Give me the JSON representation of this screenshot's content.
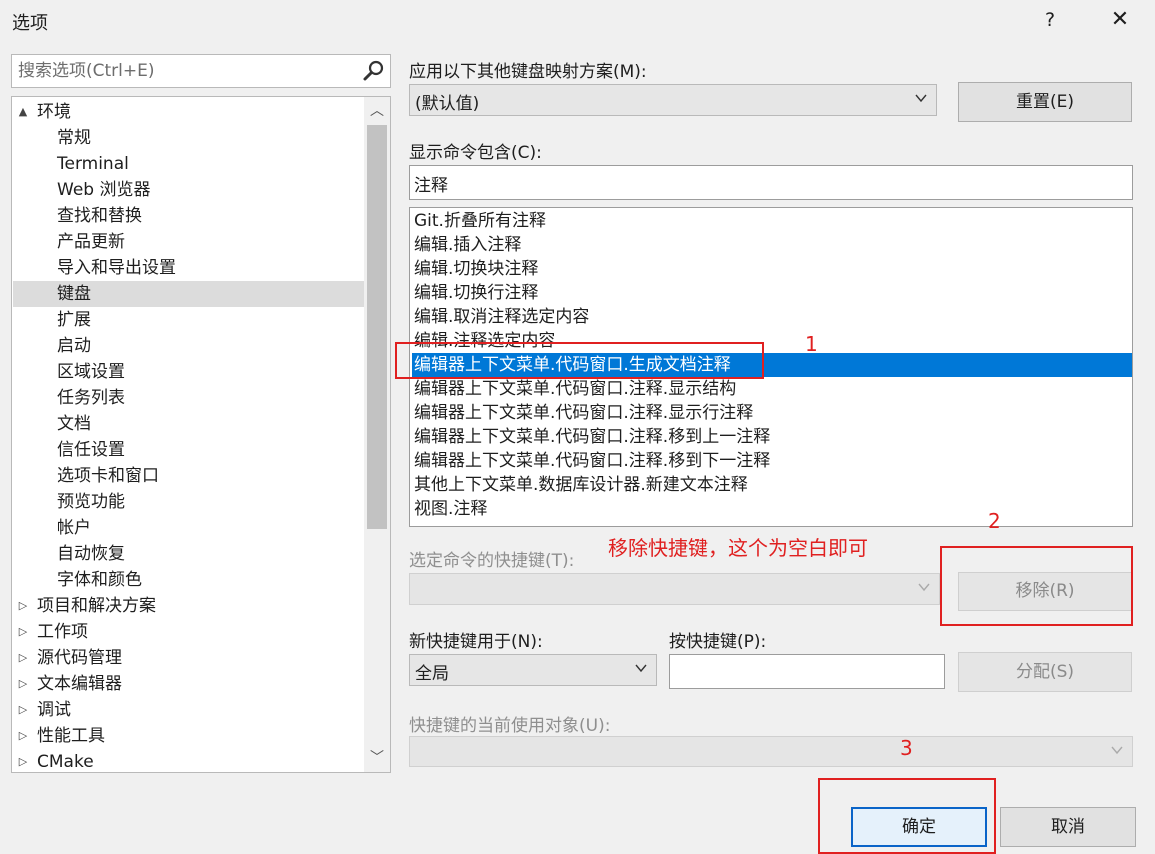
{
  "window": {
    "title": "选项",
    "help": "?",
    "close": "✕"
  },
  "search": {
    "placeholder": "搜索选项(Ctrl+E)"
  },
  "tree": {
    "items": [
      {
        "label": "环境",
        "expander": "▲",
        "level": 0
      },
      {
        "label": "常规",
        "level": 1
      },
      {
        "label": "Terminal",
        "level": 1
      },
      {
        "label": "Web 浏览器",
        "level": 1
      },
      {
        "label": "查找和替换",
        "level": 1
      },
      {
        "label": "产品更新",
        "level": 1
      },
      {
        "label": "导入和导出设置",
        "level": 1
      },
      {
        "label": "键盘",
        "level": 1,
        "selected": true
      },
      {
        "label": "扩展",
        "level": 1
      },
      {
        "label": "启动",
        "level": 1
      },
      {
        "label": "区域设置",
        "level": 1
      },
      {
        "label": "任务列表",
        "level": 1
      },
      {
        "label": "文档",
        "level": 1
      },
      {
        "label": "信任设置",
        "level": 1
      },
      {
        "label": "选项卡和窗口",
        "level": 1
      },
      {
        "label": "预览功能",
        "level": 1
      },
      {
        "label": "帐户",
        "level": 1
      },
      {
        "label": "自动恢复",
        "level": 1
      },
      {
        "label": "字体和颜色",
        "level": 1
      },
      {
        "label": "项目和解决方案",
        "expander": "▷",
        "level": 0
      },
      {
        "label": "工作项",
        "expander": "▷",
        "level": 0
      },
      {
        "label": "源代码管理",
        "expander": "▷",
        "level": 0
      },
      {
        "label": "文本编辑器",
        "expander": "▷",
        "level": 0
      },
      {
        "label": "调试",
        "expander": "▷",
        "level": 0
      },
      {
        "label": "性能工具",
        "expander": "▷",
        "level": 0
      },
      {
        "label": "CMake",
        "expander": "▷",
        "level": 0
      }
    ]
  },
  "mapping": {
    "label": "应用以下其他键盘映射方案(M):",
    "value": "(默认值)",
    "reset_label": "重置(E)"
  },
  "filter": {
    "label": "显示命令包含(C):",
    "value": "注释"
  },
  "commands": [
    "Git.折叠所有注释",
    "编辑.插入注释",
    "编辑.切换块注释",
    "编辑.切换行注释",
    "编辑.取消注释选定内容",
    "编辑.注释选定内容",
    "编辑器上下文菜单.代码窗口.生成文档注释",
    "编辑器上下文菜单.代码窗口.注释.显示结构",
    "编辑器上下文菜单.代码窗口.注释.显示行注释",
    "编辑器上下文菜单.代码窗口.注释.移到上一注释",
    "编辑器上下文菜单.代码窗口.注释.移到下一注释",
    "其他上下文菜单.数据库设计器.新建文本注释",
    "视图.注释"
  ],
  "selected_command_index": 6,
  "shortcut": {
    "label": "选定命令的快捷键(T):",
    "remove_label": "移除(R)"
  },
  "new_shortcut": {
    "label": "新快捷键用于(N):",
    "scope": "全局",
    "press_label": "按快捷键(P):",
    "assign_label": "分配(S)"
  },
  "current_use": {
    "label": "快捷键的当前使用对象(U):"
  },
  "footer": {
    "ok_label": "确定",
    "cancel_label": "取消"
  },
  "annotations": {
    "marker1": "1",
    "marker2": "2",
    "marker3": "3",
    "note": "移除快捷键，这个为空白即可",
    "color": "#e02020"
  },
  "colors": {
    "selection": "#0078d7",
    "tree_selection": "#dcdcdc",
    "primary_border": "#0a64c8"
  }
}
